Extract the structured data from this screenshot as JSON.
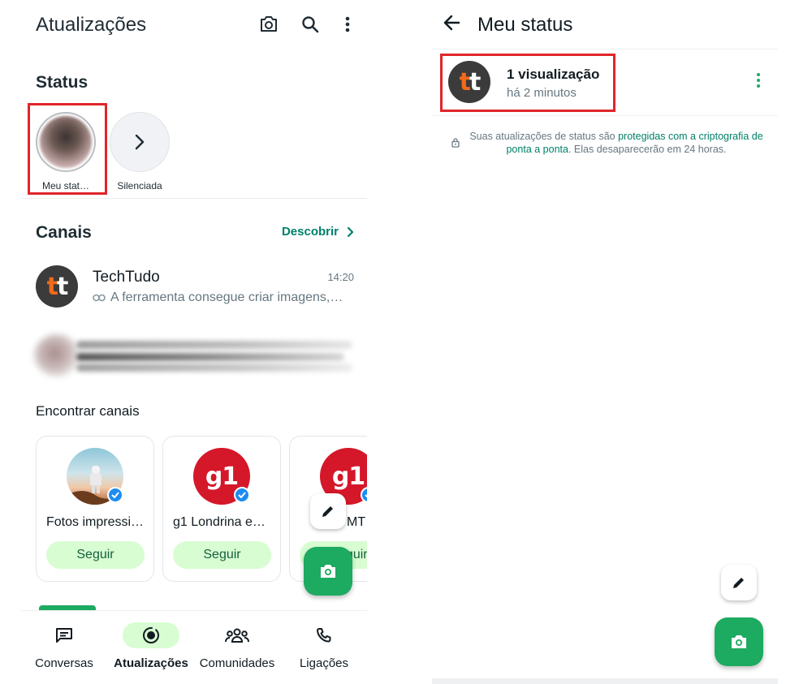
{
  "left": {
    "header": {
      "title": "Atualizações",
      "icons": [
        "camera-icon",
        "search-icon",
        "more-vertical-icon"
      ]
    },
    "status": {
      "title": "Status",
      "items": [
        {
          "label": "Meu stat…",
          "type": "my-status"
        },
        {
          "label": "Silenciada",
          "type": "muted"
        }
      ]
    },
    "channels": {
      "title": "Canais",
      "discover_label": "Descobrir",
      "items": [
        {
          "name": "TechTudo",
          "time": "14:20",
          "message": "A ferramenta consegue criar imagens,…",
          "logo_text": [
            "t",
            "t"
          ]
        }
      ]
    },
    "find_channels": {
      "title": "Encontrar canais",
      "cards": [
        {
          "name": "Fotos impressi…",
          "button": "Seguir",
          "verified": true
        },
        {
          "name": "g1 Londrina e…",
          "button": "Seguir",
          "verified": true,
          "logo_text": "g1"
        },
        {
          "name": "MT",
          "button": "Seguir",
          "verified": true,
          "logo_text": "g1"
        }
      ]
    },
    "nav": [
      {
        "label": "Conversas",
        "icon": "chats-icon",
        "active": false
      },
      {
        "label": "Atualizações",
        "icon": "updates-icon",
        "active": true
      },
      {
        "label": "Comunidades",
        "icon": "communities-icon",
        "active": false
      },
      {
        "label": "Ligações",
        "icon": "calls-icon",
        "active": false
      }
    ]
  },
  "right": {
    "header": {
      "title": "Meu status"
    },
    "status_entry": {
      "views": "1 visualização",
      "time": "há 2 minutos"
    },
    "encryption_note": {
      "prefix": "Suas atualizações de status são ",
      "link": "protegidas com a criptografia de ponta a ponta",
      "suffix": ". Elas desaparecerão em 24 horas."
    }
  },
  "colors": {
    "accent_green": "#1daa61",
    "link_green": "#008069",
    "pill_green": "#d8fdd2",
    "highlight_red": "#e0252a",
    "verified_blue": "#1d8cf0"
  }
}
